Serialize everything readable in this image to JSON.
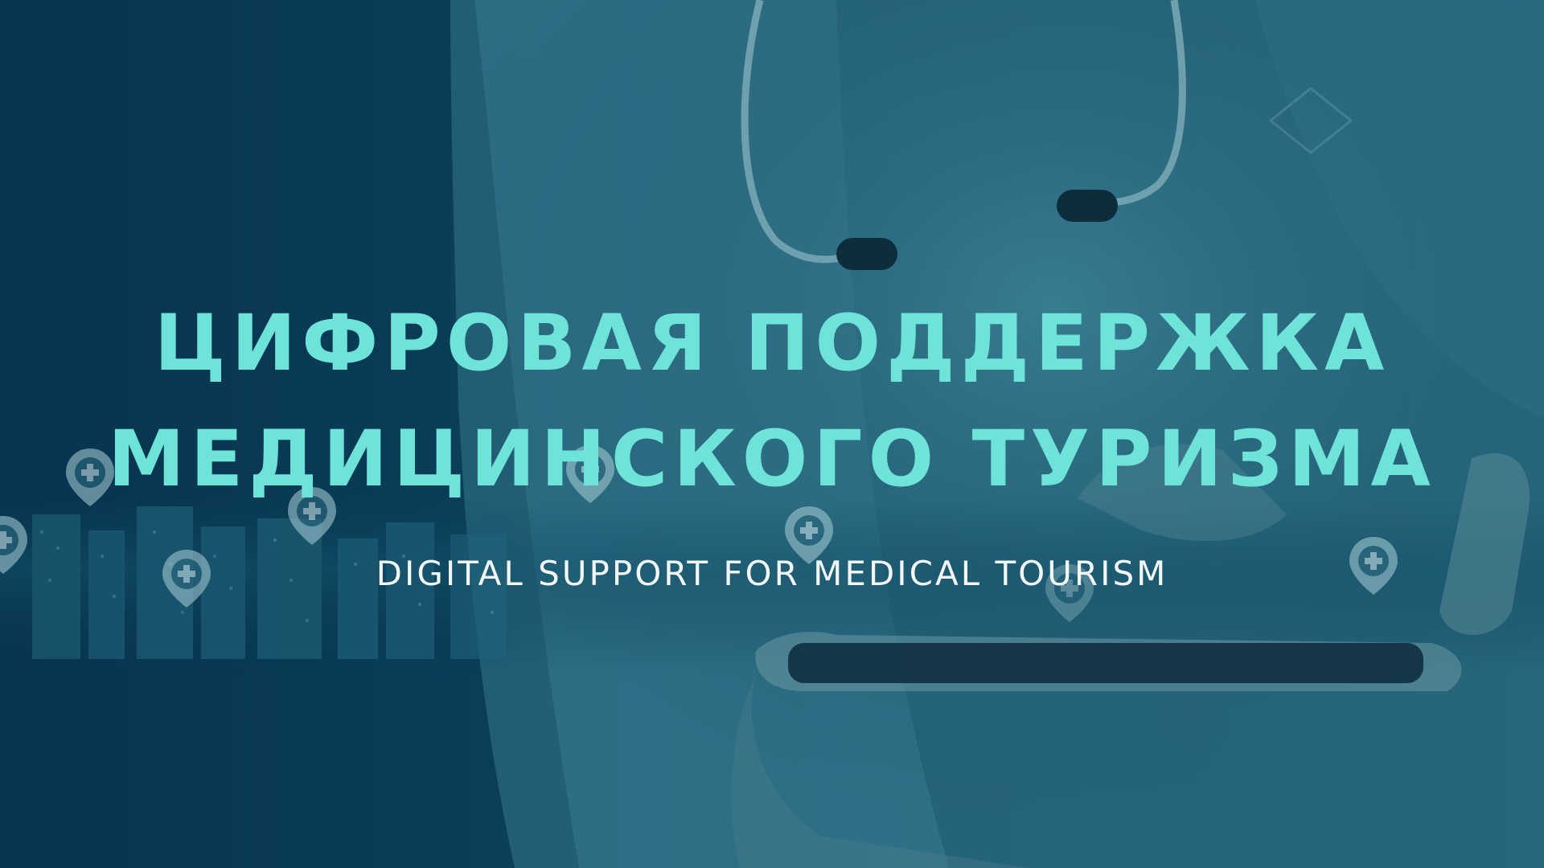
{
  "banner": {
    "title_line1": "ЦИФРОВАЯ ПОДДЕРЖКА",
    "title_line2": "МЕДИЦИНСКОГО ТУРИЗМА",
    "subtitle": "DIGITAL SUPPORT FOR MEDICAL TOURISM"
  },
  "colors": {
    "background_dark": "#073450",
    "background_teal": "#205d74",
    "title": "#6ee4d8",
    "subtitle": "#f2f7f8"
  },
  "icons": [
    "medical-location-pin-icon",
    "stethoscope-icon",
    "tablet-icon",
    "city-skyline"
  ]
}
